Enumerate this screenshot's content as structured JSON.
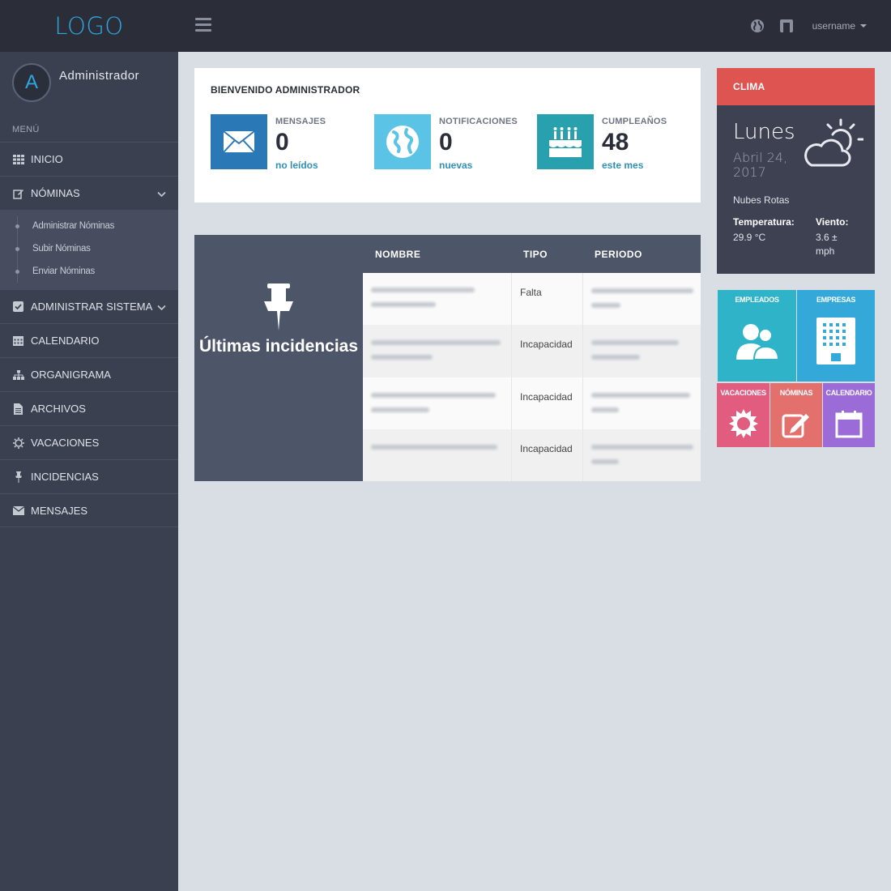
{
  "header": {
    "logo": "LOGO",
    "username": "username",
    "icons": [
      "globe-icon",
      "window-icon"
    ]
  },
  "sidebar": {
    "profile_initial": "A",
    "profile_name": "Administrador",
    "menu_label": "MENÚ",
    "items": [
      {
        "label": "INICIO",
        "icon": "grid-icon"
      },
      {
        "label": "NÓMINAS",
        "icon": "edit-icon",
        "expanded": true
      },
      {
        "label": "ADMINISTRAR SISTEMA",
        "icon": "checkbox-icon"
      },
      {
        "label": "CALENDARIO",
        "icon": "calendar-icon"
      },
      {
        "label": "ORGANIGRAMA",
        "icon": "sitemap-icon"
      },
      {
        "label": "ARCHIVOS",
        "icon": "file-icon"
      },
      {
        "label": "VACACIONES",
        "icon": "sun-icon"
      },
      {
        "label": "INCIDENCIAS",
        "icon": "pin-icon"
      },
      {
        "label": "MENSAJES",
        "icon": "envelope-icon"
      }
    ],
    "nominas_sub": [
      "Administrar Nóminas",
      "Subir Nóminas",
      "Enviar Nóminas"
    ]
  },
  "welcome": {
    "title": "BIENVENIDO ADMINISTRADOR",
    "stats": [
      {
        "label": "MENSAJES",
        "value": "0",
        "sub": "no leídos",
        "color": "#2a78b5",
        "icon": "envelope-icon"
      },
      {
        "label": "NOTIFICACIONES",
        "value": "0",
        "sub": "nuevas",
        "color": "#5bc3e6",
        "icon": "globe-icon"
      },
      {
        "label": "CUMPLEAÑOS",
        "value": "48",
        "sub": "este mes",
        "color": "#29a0ad",
        "icon": "birthday-cake-icon"
      }
    ]
  },
  "incidencias": {
    "title": "Últimas incidencias",
    "columns": [
      "NOMBRE",
      "TIPO",
      "PERIODO"
    ],
    "rows": [
      {
        "tipo": "Falta"
      },
      {
        "tipo": "Incapacidad"
      },
      {
        "tipo": "Incapacidad"
      },
      {
        "tipo": "Incapacidad"
      }
    ]
  },
  "clima": {
    "header": "CLIMA",
    "day": "Lunes",
    "date": "Abril 24, 2017",
    "description": "Nubes Rotas",
    "temp_label": "Temperatura:",
    "temp_value": "29.9 °C",
    "wind_label": "Viento:",
    "wind_value": "3.6 ± mph",
    "accent": "#de5450"
  },
  "tiles": [
    {
      "label": "EMPLEADOS",
      "color": "#2eb3c8",
      "icon": "users-icon"
    },
    {
      "label": "EMPRESAS",
      "color": "#34a8d8",
      "icon": "building-icon"
    },
    {
      "label": "VACACIONES",
      "color": "#e25c80",
      "icon": "sun-icon"
    },
    {
      "label": "NÓMINAS",
      "color": "#e4706e",
      "icon": "edit-icon"
    },
    {
      "label": "CALENDARIO",
      "color": "#9b6bd8",
      "icon": "calendar-icon"
    }
  ]
}
